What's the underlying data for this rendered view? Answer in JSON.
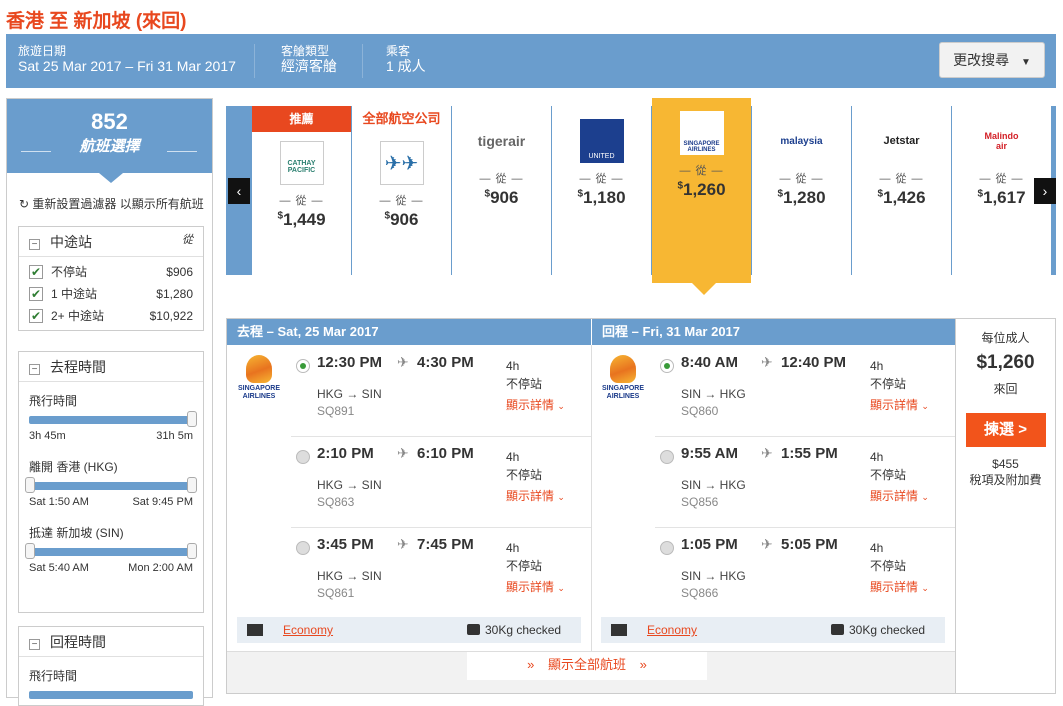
{
  "page_title": "香港 至 新加坡 (來回)",
  "search": {
    "dates_label": "旅遊日期",
    "dates_value": "Sat 25 Mar 2017 – Fri 31 Mar 2017",
    "cabin_label": "客艙類型",
    "cabin_value": "經濟客艙",
    "pax_label": "乘客",
    "pax_value": "1 成人",
    "change_label": "更改搜尋"
  },
  "sidebar": {
    "count": "852",
    "count_label": "航班選擇",
    "reset_label": "重新設置過濾器 以顯示所有航班",
    "stops": {
      "title": "中途站",
      "from_label": "從",
      "items": [
        {
          "label": "不停站",
          "price": "$906"
        },
        {
          "label": "1 中途站",
          "price": "$1,280"
        },
        {
          "label": "2+ 中途站",
          "price": "$10,922"
        }
      ]
    },
    "depart": {
      "title": "去程時間",
      "duration_label": "飛行時間",
      "duration_min": "3h 45m",
      "duration_max": "31h 5m",
      "leave_label": "離開 香港 (HKG)",
      "leave_min": "Sat 1:50 AM",
      "leave_max": "Sat 9:45 PM",
      "arrive_label": "抵達 新加坡 (SIN)",
      "arrive_min": "Sat 5:40 AM",
      "arrive_max": "Mon 2:00 AM"
    },
    "return": {
      "title": "回程時間",
      "duration_label": "飛行時間"
    }
  },
  "airlines": {
    "recommended_tag": "推薦",
    "all_airlines_label": "全部航空公司",
    "from_label": "從",
    "cards": [
      {
        "name": "CATHAY PACIFIC",
        "price": "1,449",
        "currency": "$"
      },
      {
        "name": "全部航空公司",
        "price": "906",
        "currency": "$"
      },
      {
        "name": "tigerair",
        "price": "906",
        "currency": "$"
      },
      {
        "name": "UNITED",
        "price": "1,180",
        "currency": "$"
      },
      {
        "name": "SINGAPORE AIRLINES",
        "price": "1,260",
        "currency": "$"
      },
      {
        "name": "malaysia",
        "price": "1,280",
        "currency": "$"
      },
      {
        "name": "Jetstar",
        "price": "1,426",
        "currency": "$"
      },
      {
        "name": "Malindo air",
        "price": "1,617",
        "currency": "$"
      }
    ]
  },
  "outbound": {
    "header": "去程 – Sat, 25 Mar 2017",
    "airline": "SINGAPORE AIRLINES",
    "options": [
      {
        "dep": "12:30 PM",
        "arr": "4:30 PM",
        "route": "HKG → SIN",
        "flight": "SQ891",
        "dur": "4h",
        "stops": "不停站",
        "details": "顯示詳情",
        "selected": true
      },
      {
        "dep": "2:10 PM",
        "arr": "6:10 PM",
        "route": "HKG → SIN",
        "flight": "SQ863",
        "dur": "4h",
        "stops": "不停站",
        "details": "顯示詳情",
        "selected": false
      },
      {
        "dep": "3:45 PM",
        "arr": "7:45 PM",
        "route": "HKG → SIN",
        "flight": "SQ861",
        "dur": "4h",
        "stops": "不停站",
        "details": "顯示詳情",
        "selected": false
      }
    ],
    "cabin": "Economy",
    "baggage": "30Kg checked"
  },
  "inbound": {
    "header": "回程 – Fri, 31 Mar 2017",
    "airline": "SINGAPORE AIRLINES",
    "options": [
      {
        "dep": "8:40 AM",
        "arr": "12:40 PM",
        "route": "SIN → HKG",
        "flight": "SQ860",
        "dur": "4h",
        "stops": "不停站",
        "details": "顯示詳情",
        "selected": true
      },
      {
        "dep": "9:55 AM",
        "arr": "1:55 PM",
        "route": "SIN → HKG",
        "flight": "SQ856",
        "dur": "4h",
        "stops": "不停站",
        "details": "顯示詳情",
        "selected": false
      },
      {
        "dep": "1:05 PM",
        "arr": "5:05 PM",
        "route": "SIN → HKG",
        "flight": "SQ866",
        "dur": "4h",
        "stops": "不停站",
        "details": "顯示詳情",
        "selected": false
      }
    ],
    "cabin": "Economy",
    "baggage": "30Kg checked"
  },
  "show_all_label": "顯示全部航班",
  "price_panel": {
    "per_adult": "每位成人",
    "price": "$1,260",
    "trip": "來回",
    "select_label": "揀選 >",
    "tax": "$455",
    "tax_label": "稅項及附加費"
  },
  "colors": {
    "brand_blue": "#6a9dcd",
    "accent_orange": "#e8481f",
    "selected_gold": "#f7b733"
  }
}
